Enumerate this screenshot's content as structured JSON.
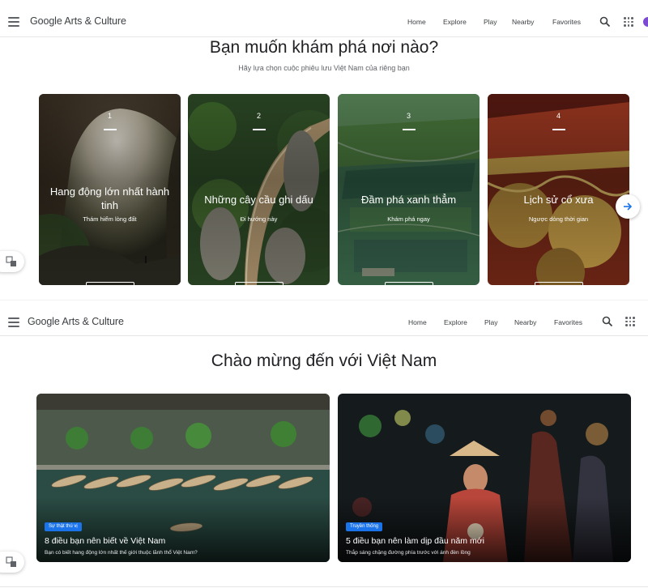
{
  "header": {
    "brand": "Google Arts & Culture",
    "nav": [
      "Home",
      "Explore",
      "Play",
      "Nearby",
      "Favorites"
    ]
  },
  "section1": {
    "title": "Bạn muốn khám phá nơi nào?",
    "subtitle": "Hãy lựa chọn cuộc phiêu lưu Việt Nam của riêng bạn",
    "cards": [
      {
        "num": "1",
        "title": "Hang động lớn nhất hành tinh",
        "sub": "Thám hiểm lòng đất"
      },
      {
        "num": "2",
        "title": "Những cây cầu ghi dấu",
        "sub": "Đi hướng này"
      },
      {
        "num": "3",
        "title": "Đầm phá xanh thẳm",
        "sub": "Khám phá ngay"
      },
      {
        "num": "4",
        "title": "Lịch sử cổ xưa",
        "sub": "Ngược dòng thời gian"
      }
    ]
  },
  "section2": {
    "title": "Chào mừng đến với Việt Nam",
    "stories": [
      {
        "tag": "Sự thật thú vị",
        "title": "8 điều bạn nên biết về Việt Nam",
        "sub": "Bạn có biết hang động lớn nhất thế giới thuộc lãnh thổ Việt Nam?"
      },
      {
        "tag": "Truyền thống",
        "title": "5 điều bạn nên làm dịp đầu năm mới",
        "sub": "Thắp sáng chặng đường phía trước với ánh đèn lồng"
      }
    ]
  },
  "icons": {
    "menu": "hamburger-icon",
    "search": "search-icon",
    "apps": "apps-grid-icon",
    "next": "arrow-right-icon",
    "translate": "translate-icon"
  },
  "colors": {
    "accent": "#1a73e8",
    "tag": "#1a73e8"
  }
}
